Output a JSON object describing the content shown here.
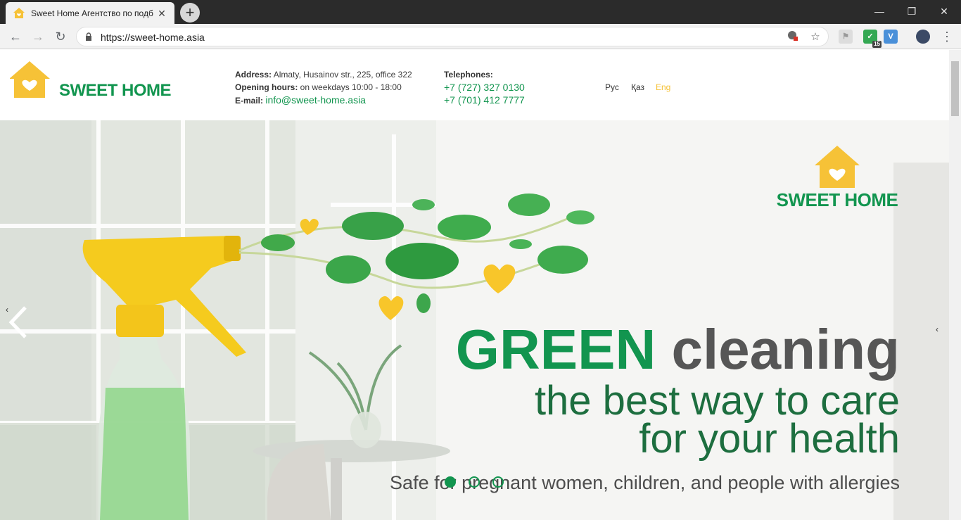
{
  "browser": {
    "tab_title": "Sweet Home Агентство по подб",
    "tab_close": "✕",
    "new_tab": "+",
    "url": "https://sweet-home.asia",
    "window_controls": {
      "minimize": "—",
      "restore": "❐",
      "close": "✕"
    },
    "nav": {
      "back": "←",
      "forward": "→",
      "reload": "↻"
    },
    "extension_badge": "15",
    "ext_v_label": "V"
  },
  "site": {
    "logo_text": "SWEET HOME",
    "contacts": {
      "address_label": "Address:",
      "address_value": "Almaty, Husainov str., 225, office 322",
      "hours_label": "Opening hours:",
      "hours_value": "on weekdays 10:00 - 18:00",
      "email_label": "E-mail:",
      "email_value": "info@sweet-home.asia"
    },
    "phones": {
      "label": "Telephones:",
      "phone_1": "+7 (727) 327 0130",
      "phone_2": "+7 (701) 412 7777"
    },
    "languages": [
      "Рус",
      "Қаз",
      "Eng"
    ],
    "active_language": "Eng"
  },
  "hero": {
    "logo_text": "SWEET HOME",
    "headline_green": "GREEN",
    "headline_gray": " cleaning",
    "subline_1": "the best way to care",
    "subline_2": "for your health",
    "tagline": "Safe for pregnant women, children, and people with allergies",
    "slide_count": 3,
    "active_slide": 1,
    "arrow_left_small": "‹",
    "arrow_right": "‹"
  },
  "colors": {
    "brand_green": "#12954f",
    "brand_yellow": "#f6c237",
    "dark_green": "#1d6e3f"
  }
}
